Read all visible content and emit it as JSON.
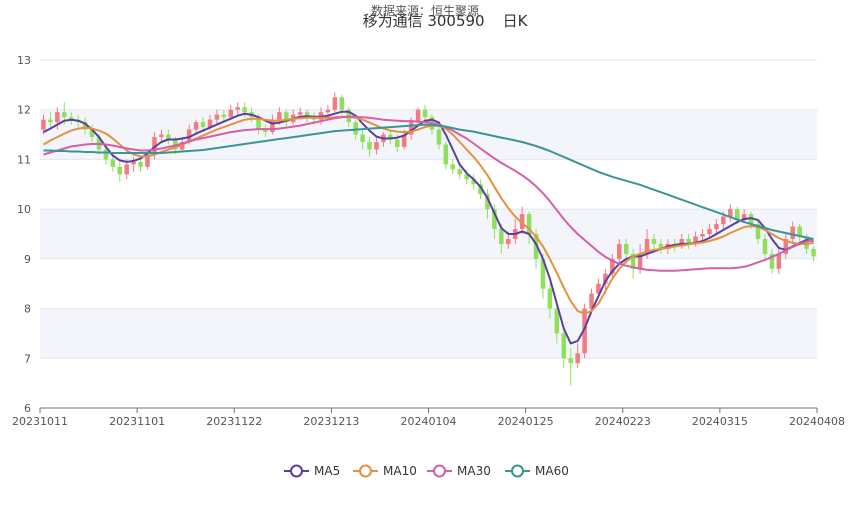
{
  "chart_data": {
    "type": "candlestick",
    "title": "移为通信 300590",
    "period_label": "日K",
    "subtitle": "数据来源：恒生聚源",
    "ylim": [
      6,
      13
    ],
    "y_ticks": [
      "6",
      "7",
      "8",
      "9",
      "10",
      "11",
      "12",
      "13"
    ],
    "x_ticks": [
      "20231011",
      "20231101",
      "20231122",
      "20231213",
      "20240104",
      "20240125",
      "20240223",
      "20240315",
      "20240408"
    ],
    "colors": {
      "up": "#f07c82",
      "down": "#8ee05b",
      "MA5": "#5b3f9e",
      "MA10": "#e5913e",
      "MA30": "#d55fa8",
      "MA60": "#3b9596",
      "band": "#f4f5fb",
      "grid": "#e3e6ef",
      "axis": "#6e7079"
    },
    "candles": [
      [
        11.6,
        11.8,
        11.5,
        11.9
      ],
      [
        11.8,
        11.75,
        11.6,
        11.95
      ],
      [
        11.75,
        11.95,
        11.6,
        12.05
      ],
      [
        11.95,
        11.85,
        11.7,
        12.15
      ],
      [
        11.85,
        11.8,
        11.7,
        11.95
      ],
      [
        11.8,
        11.75,
        11.65,
        11.9
      ],
      [
        11.75,
        11.6,
        11.5,
        11.85
      ],
      [
        11.6,
        11.45,
        11.35,
        11.7
      ],
      [
        11.45,
        11.2,
        11.1,
        11.5
      ],
      [
        11.2,
        11.0,
        10.9,
        11.3
      ],
      [
        11.0,
        10.85,
        10.75,
        11.1
      ],
      [
        10.85,
        10.7,
        10.55,
        10.95
      ],
      [
        10.7,
        10.9,
        10.6,
        11.0
      ],
      [
        10.9,
        10.95,
        10.75,
        11.05
      ],
      [
        10.95,
        10.85,
        10.75,
        11.05
      ],
      [
        10.85,
        11.1,
        10.8,
        11.2
      ],
      [
        11.1,
        11.45,
        11.0,
        11.55
      ],
      [
        11.45,
        11.5,
        11.35,
        11.6
      ],
      [
        11.5,
        11.4,
        11.3,
        11.6
      ],
      [
        11.4,
        11.2,
        11.1,
        11.45
      ],
      [
        11.2,
        11.35,
        11.15,
        11.45
      ],
      [
        11.35,
        11.6,
        11.3,
        11.7
      ],
      [
        11.6,
        11.75,
        11.5,
        11.8
      ],
      [
        11.75,
        11.65,
        11.55,
        11.85
      ],
      [
        11.65,
        11.8,
        11.6,
        11.9
      ],
      [
        11.8,
        11.9,
        11.7,
        12.0
      ],
      [
        11.9,
        11.85,
        11.75,
        12.0
      ],
      [
        11.85,
        12.0,
        11.8,
        12.1
      ],
      [
        12.0,
        12.05,
        11.9,
        12.15
      ],
      [
        12.05,
        11.95,
        11.85,
        12.15
      ],
      [
        11.95,
        11.85,
        11.75,
        12.05
      ],
      [
        11.85,
        11.6,
        11.5,
        11.9
      ],
      [
        11.6,
        11.55,
        11.45,
        11.7
      ],
      [
        11.55,
        11.8,
        11.5,
        11.9
      ],
      [
        11.8,
        11.95,
        11.7,
        12.05
      ],
      [
        11.95,
        11.75,
        11.65,
        12.0
      ],
      [
        11.75,
        11.9,
        11.7,
        12.0
      ],
      [
        11.9,
        11.95,
        11.8,
        12.05
      ],
      [
        11.95,
        11.85,
        11.75,
        12.0
      ],
      [
        11.85,
        11.8,
        11.7,
        11.95
      ],
      [
        11.8,
        11.95,
        11.7,
        12.05
      ],
      [
        11.95,
        12.0,
        11.85,
        12.1
      ],
      [
        12.0,
        12.25,
        11.95,
        12.35
      ],
      [
        12.25,
        12.0,
        11.9,
        12.3
      ],
      [
        12.0,
        11.75,
        11.65,
        12.05
      ],
      [
        11.75,
        11.5,
        11.4,
        11.8
      ],
      [
        11.5,
        11.35,
        11.2,
        11.6
      ],
      [
        11.35,
        11.2,
        11.05,
        11.45
      ],
      [
        11.2,
        11.35,
        11.1,
        11.45
      ],
      [
        11.35,
        11.5,
        11.25,
        11.55
      ],
      [
        11.5,
        11.4,
        11.3,
        11.6
      ],
      [
        11.4,
        11.25,
        11.15,
        11.5
      ],
      [
        11.25,
        11.5,
        11.2,
        11.6
      ],
      [
        11.5,
        11.75,
        11.4,
        11.85
      ],
      [
        11.75,
        12.0,
        11.7,
        12.05
      ],
      [
        12.0,
        11.85,
        11.75,
        12.1
      ],
      [
        11.85,
        11.6,
        11.5,
        11.9
      ],
      [
        11.6,
        11.3,
        11.2,
        11.7
      ],
      [
        11.3,
        10.9,
        10.8,
        11.35
      ],
      [
        10.9,
        10.8,
        10.7,
        11.0
      ],
      [
        10.8,
        10.7,
        10.6,
        10.9
      ],
      [
        10.7,
        10.6,
        10.5,
        10.8
      ],
      [
        10.6,
        10.5,
        10.4,
        10.7
      ],
      [
        10.5,
        10.3,
        10.2,
        10.6
      ],
      [
        10.3,
        10.0,
        9.8,
        10.4
      ],
      [
        10.0,
        9.6,
        9.4,
        10.1
      ],
      [
        9.6,
        9.3,
        9.1,
        9.7
      ],
      [
        9.3,
        9.4,
        9.2,
        9.55
      ],
      [
        9.4,
        9.6,
        9.3,
        9.8
      ],
      [
        9.6,
        9.9,
        9.5,
        10.05
      ],
      [
        9.9,
        9.5,
        9.3,
        9.95
      ],
      [
        9.5,
        9.0,
        8.8,
        9.6
      ],
      [
        9.0,
        8.4,
        8.2,
        9.1
      ],
      [
        8.4,
        8.0,
        7.8,
        8.5
      ],
      [
        8.0,
        7.5,
        7.3,
        8.1
      ],
      [
        7.5,
        7.0,
        6.8,
        7.6
      ],
      [
        7.0,
        6.9,
        6.45,
        7.2
      ],
      [
        6.9,
        7.1,
        6.8,
        7.3
      ],
      [
        7.1,
        8.0,
        7.0,
        8.1
      ],
      [
        8.0,
        8.3,
        7.9,
        8.4
      ],
      [
        8.3,
        8.5,
        8.2,
        8.6
      ],
      [
        8.5,
        8.7,
        8.3,
        8.8
      ],
      [
        8.7,
        9.0,
        8.6,
        9.1
      ],
      [
        9.0,
        9.3,
        8.9,
        9.4
      ],
      [
        9.3,
        9.1,
        8.9,
        9.4
      ],
      [
        9.1,
        8.8,
        8.6,
        9.2
      ],
      [
        8.8,
        9.1,
        8.7,
        9.3
      ],
      [
        9.1,
        9.4,
        9.0,
        9.6
      ],
      [
        9.4,
        9.3,
        9.2,
        9.5
      ],
      [
        9.3,
        9.2,
        9.1,
        9.4
      ],
      [
        9.2,
        9.3,
        9.1,
        9.4
      ],
      [
        9.3,
        9.25,
        9.15,
        9.4
      ],
      [
        9.25,
        9.4,
        9.2,
        9.5
      ],
      [
        9.4,
        9.3,
        9.2,
        9.5
      ],
      [
        9.3,
        9.45,
        9.25,
        9.55
      ],
      [
        9.45,
        9.5,
        9.35,
        9.6
      ],
      [
        9.5,
        9.6,
        9.4,
        9.7
      ],
      [
        9.6,
        9.7,
        9.5,
        9.8
      ],
      [
        9.7,
        9.85,
        9.6,
        9.95
      ],
      [
        9.85,
        10.0,
        9.75,
        10.1
      ],
      [
        10.0,
        9.8,
        9.7,
        10.05
      ],
      [
        9.8,
        9.9,
        9.75,
        10.0
      ],
      [
        9.9,
        9.7,
        9.6,
        9.95
      ],
      [
        9.7,
        9.4,
        9.3,
        9.8
      ],
      [
        9.4,
        9.1,
        9.0,
        9.5
      ],
      [
        9.1,
        8.8,
        8.7,
        9.2
      ],
      [
        8.8,
        9.1,
        8.7,
        9.25
      ],
      [
        9.1,
        9.4,
        9.0,
        9.5
      ],
      [
        9.4,
        9.65,
        9.3,
        9.75
      ],
      [
        9.65,
        9.45,
        9.35,
        9.7
      ],
      [
        9.45,
        9.2,
        9.1,
        9.5
      ],
      [
        9.2,
        9.05,
        8.95,
        9.25
      ]
    ],
    "series": [
      {
        "name": "MA5",
        "values": [
          11.55,
          11.62,
          11.7,
          11.78,
          11.8,
          11.78,
          11.72,
          11.6,
          11.45,
          11.25,
          11.08,
          10.98,
          10.95,
          10.97,
          11.02,
          11.12,
          11.25,
          11.35,
          11.4,
          11.4,
          11.42,
          11.45,
          11.52,
          11.58,
          11.64,
          11.7,
          11.76,
          11.82,
          11.88,
          11.92,
          11.9,
          11.85,
          11.78,
          11.72,
          11.74,
          11.78,
          11.82,
          11.86,
          11.87,
          11.86,
          11.86,
          11.88,
          11.92,
          11.96,
          11.96,
          11.88,
          11.72,
          11.58,
          11.46,
          11.42,
          11.42,
          11.44,
          11.48,
          11.58,
          11.68,
          11.78,
          11.8,
          11.74,
          11.5,
          11.2,
          10.9,
          10.72,
          10.6,
          10.45,
          10.22,
          9.92,
          9.62,
          9.5,
          9.5,
          9.55,
          9.5,
          9.3,
          9.0,
          8.6,
          8.1,
          7.6,
          7.3,
          7.35,
          7.6,
          7.95,
          8.25,
          8.55,
          8.75,
          8.9,
          9.0,
          9.05,
          9.05,
          9.1,
          9.15,
          9.2,
          9.25,
          9.28,
          9.3,
          9.3,
          9.32,
          9.36,
          9.42,
          9.5,
          9.58,
          9.66,
          9.74,
          9.8,
          9.82,
          9.78,
          9.62,
          9.4,
          9.22,
          9.18,
          9.25,
          9.32,
          9.38,
          9.36
        ]
      },
      {
        "name": "MA10",
        "values": [
          11.3,
          11.38,
          11.45,
          11.52,
          11.58,
          11.62,
          11.64,
          11.62,
          11.58,
          11.52,
          11.42,
          11.3,
          11.18,
          11.1,
          11.06,
          11.06,
          11.1,
          11.15,
          11.2,
          11.24,
          11.3,
          11.36,
          11.42,
          11.48,
          11.54,
          11.6,
          11.65,
          11.7,
          11.75,
          11.8,
          11.82,
          11.82,
          11.8,
          11.78,
          11.78,
          11.8,
          11.82,
          11.83,
          11.84,
          11.84,
          11.84,
          11.84,
          11.85,
          11.86,
          11.86,
          11.84,
          11.8,
          11.74,
          11.68,
          11.62,
          11.58,
          11.56,
          11.55,
          11.56,
          11.6,
          11.65,
          11.68,
          11.68,
          11.62,
          11.5,
          11.35,
          11.2,
          11.05,
          10.88,
          10.68,
          10.45,
          10.22,
          10.02,
          9.85,
          9.72,
          9.6,
          9.45,
          9.25,
          9.0,
          8.72,
          8.42,
          8.15,
          7.95,
          7.9,
          7.95,
          8.1,
          8.35,
          8.6,
          8.8,
          8.95,
          9.05,
          9.1,
          9.15,
          9.18,
          9.2,
          9.22,
          9.25,
          9.27,
          9.29,
          9.31,
          9.33,
          9.36,
          9.4,
          9.45,
          9.52,
          9.58,
          9.64,
          9.66,
          9.64,
          9.58,
          9.5,
          9.42,
          9.36,
          9.32,
          9.3,
          9.3,
          9.32
        ]
      },
      {
        "name": "MA30",
        "values": [
          11.1,
          11.14,
          11.18,
          11.22,
          11.26,
          11.28,
          11.3,
          11.31,
          11.31,
          11.3,
          11.28,
          11.25,
          11.22,
          11.2,
          11.18,
          11.18,
          11.2,
          11.22,
          11.25,
          11.28,
          11.32,
          11.36,
          11.4,
          11.43,
          11.46,
          11.49,
          11.52,
          11.55,
          11.57,
          11.59,
          11.6,
          11.61,
          11.61,
          11.61,
          11.62,
          11.64,
          11.66,
          11.68,
          11.71,
          11.74,
          11.77,
          11.8,
          11.83,
          11.85,
          11.86,
          11.86,
          11.85,
          11.84,
          11.82,
          11.8,
          11.79,
          11.78,
          11.77,
          11.77,
          11.76,
          11.75,
          11.73,
          11.7,
          11.65,
          11.58,
          11.5,
          11.42,
          11.32,
          11.22,
          11.12,
          11.02,
          10.93,
          10.85,
          10.77,
          10.68,
          10.58,
          10.46,
          10.32,
          10.16,
          9.98,
          9.8,
          9.64,
          9.5,
          9.38,
          9.26,
          9.14,
          9.04,
          8.96,
          8.9,
          8.86,
          8.83,
          8.8,
          8.78,
          8.77,
          8.76,
          8.76,
          8.76,
          8.77,
          8.78,
          8.79,
          8.8,
          8.81,
          8.81,
          8.81,
          8.81,
          8.82,
          8.84,
          8.88,
          8.93,
          8.98,
          9.04,
          9.1,
          9.17,
          9.24,
          9.3,
          9.35,
          9.38
        ]
      },
      {
        "name": "MA60",
        "values": [
          11.18,
          11.18,
          11.17,
          11.17,
          11.16,
          11.16,
          11.15,
          11.15,
          11.14,
          11.14,
          11.13,
          11.13,
          11.13,
          11.13,
          11.13,
          11.13,
          11.13,
          11.13,
          11.14,
          11.15,
          11.16,
          11.17,
          11.18,
          11.19,
          11.21,
          11.23,
          11.25,
          11.27,
          11.29,
          11.31,
          11.33,
          11.35,
          11.37,
          11.39,
          11.41,
          11.43,
          11.45,
          11.47,
          11.49,
          11.51,
          11.53,
          11.55,
          11.57,
          11.58,
          11.59,
          11.6,
          11.61,
          11.62,
          11.63,
          11.64,
          11.65,
          11.66,
          11.67,
          11.68,
          11.69,
          11.7,
          11.69,
          11.68,
          11.66,
          11.63,
          11.6,
          11.58,
          11.56,
          11.53,
          11.5,
          11.47,
          11.44,
          11.41,
          11.38,
          11.35,
          11.31,
          11.27,
          11.22,
          11.17,
          11.11,
          11.05,
          10.99,
          10.93,
          10.87,
          10.81,
          10.75,
          10.7,
          10.65,
          10.61,
          10.57,
          10.53,
          10.49,
          10.44,
          10.39,
          10.34,
          10.29,
          10.24,
          10.19,
          10.14,
          10.09,
          10.04,
          9.99,
          9.94,
          9.89,
          9.84,
          9.79,
          9.74,
          9.7,
          9.66,
          9.62,
          9.58,
          9.55,
          9.52,
          9.49,
          9.46,
          9.43,
          9.4
        ]
      }
    ]
  }
}
